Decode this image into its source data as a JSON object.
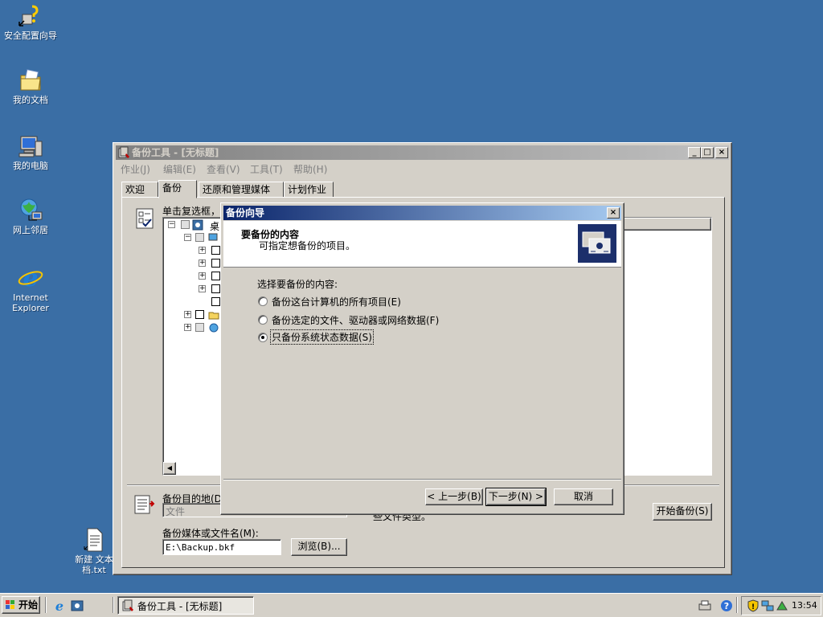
{
  "desktop": {
    "icons": [
      {
        "label": "安全配置向导",
        "icon": "security-wizard-icon"
      },
      {
        "label": "我的文档",
        "icon": "my-documents-icon"
      },
      {
        "label": "我的电脑",
        "icon": "my-computer-icon"
      },
      {
        "label": "网上邻居",
        "icon": "network-places-icon"
      },
      {
        "label": "Internet",
        "label2": "Explorer",
        "icon": "internet-explorer-icon"
      },
      {
        "label": "新建 文本",
        "label2": "档.txt",
        "icon": "text-file-icon"
      }
    ]
  },
  "main_window": {
    "title": "备份工具 - [无标题]",
    "menu": [
      "作业(J)",
      "编辑(E)",
      "查看(V)",
      "工具(T)",
      "帮助(H)"
    ],
    "tabs": [
      "欢迎",
      "备份",
      "还原和管理媒体",
      "计划作业"
    ],
    "selected_tab": "备份",
    "tree_hint": "单击复选框，",
    "tree_root": "桌",
    "dest_label": "备份目的地(D):",
    "dest_value": "文件",
    "media_label": "备份媒体或文件名(M):",
    "media_value": "E:\\Backup.bkf",
    "browse_button": "浏览(B)...",
    "start_button": "开始备份(S)",
    "partial_text": "些文件类型。"
  },
  "wizard": {
    "title": "备份向导",
    "header_title": "要备份的内容",
    "header_subtitle": "可指定想备份的项目。",
    "prompt": "选择要备份的内容:",
    "options": [
      {
        "label": "备份这台计算机的所有项目(E)",
        "selected": false
      },
      {
        "label": "备份选定的文件、驱动器或网络数据(F)",
        "selected": false
      },
      {
        "label": "只备份系统状态数据(S)",
        "selected": true
      }
    ],
    "back_button": "< 上一步(B)",
    "next_button": "下一步(N) >",
    "cancel_button": "取消"
  },
  "taskbar": {
    "start_label": "开始",
    "task_label": "备份工具 - [无标题]",
    "clock": "13:54"
  }
}
